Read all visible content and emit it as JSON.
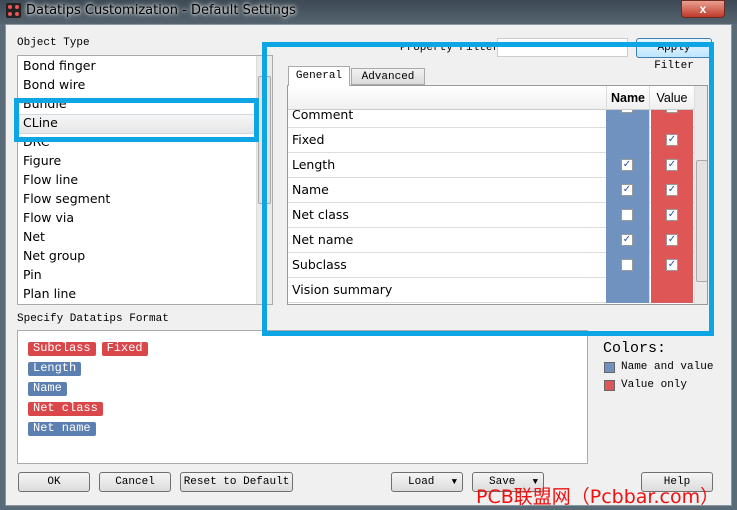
{
  "window": {
    "title": "Datatips Customization - Default Settings",
    "close_label": "x"
  },
  "object_type": {
    "label": "Object Type",
    "items": [
      "Bond finger",
      "Bond wire",
      "Bundle",
      "CLine",
      "DRC",
      "Figure",
      "Flow line",
      "Flow segment",
      "Flow via",
      "Net",
      "Net group",
      "Pin",
      "Plan line"
    ],
    "selected": "CLine"
  },
  "filter": {
    "label": "Property Filter",
    "value": "",
    "apply_label": "Apply Filter"
  },
  "tabs": [
    {
      "label": "General",
      "active": true
    },
    {
      "label": "Advanced",
      "active": false
    }
  ],
  "table": {
    "headers": [
      "",
      "Name",
      "Value"
    ],
    "rows": [
      {
        "label": "Comment",
        "name": false,
        "value": false,
        "name_cb": true,
        "value_cb": true
      },
      {
        "label": "Fixed",
        "name": null,
        "value": true
      },
      {
        "label": "Length",
        "name": true,
        "value": true
      },
      {
        "label": "Name",
        "name": true,
        "value": true
      },
      {
        "label": "Net class",
        "name": false,
        "value": true
      },
      {
        "label": "Net name",
        "name": true,
        "value": true
      },
      {
        "label": "Subclass",
        "name": false,
        "value": true
      },
      {
        "label": "Vision summary",
        "name": null,
        "value": null
      }
    ]
  },
  "format": {
    "label": "Specify Datatips Format",
    "lines": [
      [
        {
          "text": "Subclass",
          "kind": "value"
        },
        {
          "text": "Fixed",
          "kind": "value"
        }
      ],
      [
        {
          "text": "Length",
          "kind": "name"
        }
      ],
      [
        {
          "text": "Name",
          "kind": "name"
        }
      ],
      [
        {
          "text": "Net class",
          "kind": "value"
        }
      ],
      [
        {
          "text": "Net name",
          "kind": "name"
        }
      ]
    ]
  },
  "colors": {
    "label": "Colors:",
    "name_and_value": "Name and value",
    "value_only": "Value only",
    "name_color": "#7092bf",
    "value_color": "#de5656"
  },
  "buttons": {
    "ok": "OK",
    "cancel": "Cancel",
    "reset": "Reset to Default",
    "load": "Load",
    "save": "Save",
    "help": "Help"
  },
  "watermark": "PCB联盟网（Pcbbar.com）"
}
